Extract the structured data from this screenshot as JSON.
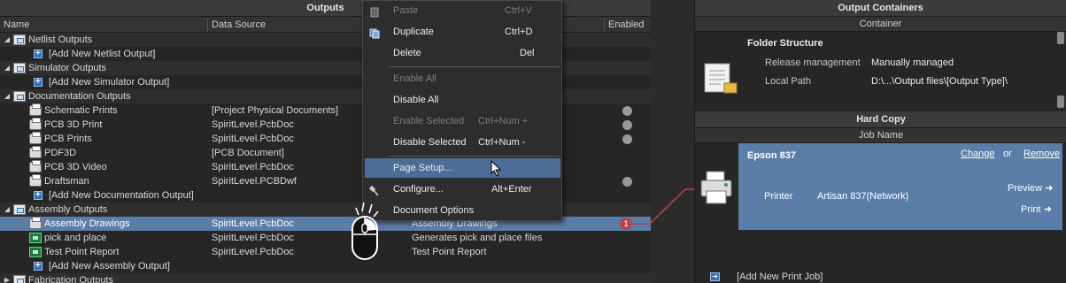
{
  "outputs_panel": {
    "title": "Outputs",
    "columns": {
      "name": "Name",
      "data_source": "Data Source",
      "enabled": "Enabled"
    }
  },
  "rows": [
    {
      "kind": "group",
      "name": "Netlist Outputs"
    },
    {
      "kind": "add",
      "name": "[Add New Netlist Output]"
    },
    {
      "kind": "group",
      "name": "Simulator Outputs"
    },
    {
      "kind": "add",
      "name": "[Add New Simulator Output]"
    },
    {
      "kind": "group",
      "name": "Documentation Outputs"
    },
    {
      "kind": "print",
      "name": "Schematic Prints",
      "source": "[Project Physical Documents]",
      "enabled_dot": true
    },
    {
      "kind": "print",
      "name": "PCB 3D Print",
      "source": "SpiritLevel.PcbDoc",
      "enabled_dot": true
    },
    {
      "kind": "print",
      "name": "PCB Prints",
      "source": "SpiritLevel.PcbDoc",
      "enabled_dot": true
    },
    {
      "kind": "print",
      "name": "PDF3D",
      "source": "[PCB Document]"
    },
    {
      "kind": "print",
      "name": "PCB 3D Video",
      "source": "SpiritLevel.PcbDoc"
    },
    {
      "kind": "print",
      "name": "Draftsman",
      "source": "SpiritLevel.PCBDwf",
      "enabled_dot": true
    },
    {
      "kind": "add",
      "name": "[Add New Documentation Output]"
    },
    {
      "kind": "group",
      "name": "Assembly Outputs"
    },
    {
      "kind": "print",
      "name": "Assembly Drawings",
      "source": "SpiritLevel.PcbDoc",
      "description": "Assembly Drawings",
      "selected": true,
      "badge": "1"
    },
    {
      "kind": "chip",
      "name": "pick and place",
      "source": "SpiritLevel.PcbDoc",
      "description": "Generates pick and place files"
    },
    {
      "kind": "chip",
      "name": "Test Point Report",
      "source": "SpiritLevel.PcbDoc",
      "description": "Test Point Report"
    },
    {
      "kind": "add",
      "name": "[Add New Assembly Output]"
    },
    {
      "kind": "group",
      "name": "Fabrication Outputs",
      "collapsed": true
    }
  ],
  "context_menu": [
    {
      "label": "Paste",
      "shortcut": "Ctrl+V",
      "disabled": true,
      "icon": "paste-icon"
    },
    {
      "label": "Duplicate",
      "shortcut": "Ctrl+D",
      "icon": "duplicate-icon"
    },
    {
      "label": "Delete",
      "shortcut": "Del"
    },
    {
      "separator": true
    },
    {
      "label": "Enable All",
      "disabled": true
    },
    {
      "label": "Disable All"
    },
    {
      "label": "Enable Selected",
      "shortcut": "Ctrl+Num +",
      "disabled": true
    },
    {
      "label": "Disable Selected",
      "shortcut": "Ctrl+Num -"
    },
    {
      "separator": true
    },
    {
      "label": "Page Setup...",
      "highlighted": true
    },
    {
      "label": "Configure...",
      "shortcut": "Alt+Enter",
      "icon": "wrench-icon"
    },
    {
      "label": "Document Options"
    }
  ],
  "output_containers": {
    "title": "Output Containers",
    "column": "Container",
    "folder_title": "Folder Structure",
    "release_label": "Release management",
    "release_value": "Manually managed",
    "path_label": "Local Path",
    "path_value": "D:\\...\\Output files\\[Output Type]\\"
  },
  "hard_copy": {
    "title": "Hard Copy",
    "column": "Job Name",
    "job_name": "Epson 837",
    "change": "Change",
    "or": "or",
    "remove": "Remove",
    "printer_label": "Printer",
    "printer_value": "Artisan 837(Network)",
    "preview": "Preview",
    "print": "Print",
    "add_job": "[Add New Print Job]"
  },
  "colors": {
    "selection": "#5b7ea8",
    "menu_highlight": "#4d6d96",
    "connector": "#b5474a"
  }
}
